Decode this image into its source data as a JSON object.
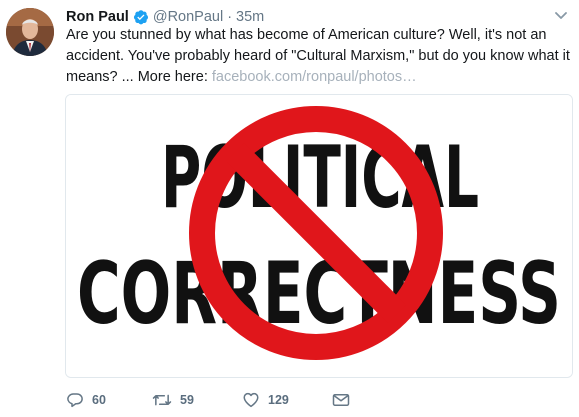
{
  "tweet": {
    "author_name": "Ron Paul",
    "handle": "@RonPaul",
    "separator": "·",
    "time": "35m",
    "text": "Are you stunned by what has become of American culture? Well, it's not an accident. You've probably heard of \"Cultural Marxism,\" but do you know what it means? ... More here: ",
    "link": "facebook.com/ronpaul/photos…",
    "image": {
      "line1": "POLITICAL",
      "line2": "CORRECTNESS",
      "symbol": "prohibition-sign",
      "symbol_color": "#e0161b"
    },
    "actions": {
      "replies": "60",
      "retweets": "59",
      "likes": "129"
    }
  },
  "colors": {
    "verified": "#1da1f2",
    "muted": "#657786",
    "link": "#a7b1bb"
  }
}
